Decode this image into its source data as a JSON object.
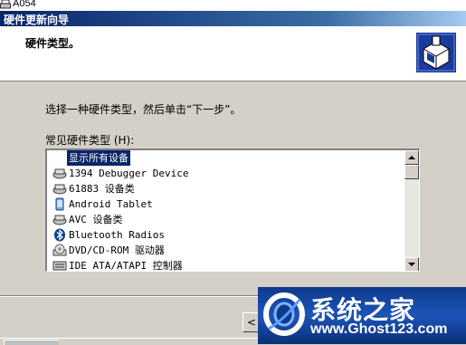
{
  "underlying_window": {
    "title": "A054"
  },
  "window": {
    "title": "硬件更新向导"
  },
  "header": {
    "title": "硬件类型。",
    "icon": "hardware-wizard-icon"
  },
  "instruction": "选择一种硬件类型，然后单击“下一步”。",
  "list": {
    "label": "常见硬件类型 (H):",
    "items": [
      {
        "label": "显示所有设备",
        "icon": "none",
        "selected": true
      },
      {
        "label": "1394 Debugger Device",
        "icon": "network-device-icon"
      },
      {
        "label": "61883 设备类",
        "icon": "network-device-icon"
      },
      {
        "label": "Android Tablet",
        "icon": "tablet-icon"
      },
      {
        "label": "AVC 设备类",
        "icon": "network-device-icon"
      },
      {
        "label": "Bluetooth Radios",
        "icon": "bluetooth-icon"
      },
      {
        "label": "DVD/CD-ROM 驱动器",
        "icon": "cdrom-icon"
      },
      {
        "label": "IDE ATA/ATAPI 控制器",
        "icon": "ide-controller-icon"
      }
    ]
  },
  "buttons": {
    "back": "< "
  },
  "watermark": {
    "title": "系统之家",
    "url": "www.Ghost123.com"
  },
  "colors": {
    "selection": "#0a246a",
    "dialog_bg": "#d4d0c8",
    "title_start": "#0a246a",
    "title_end": "#a6caf0",
    "watermark_bg": "#1d54b8"
  }
}
